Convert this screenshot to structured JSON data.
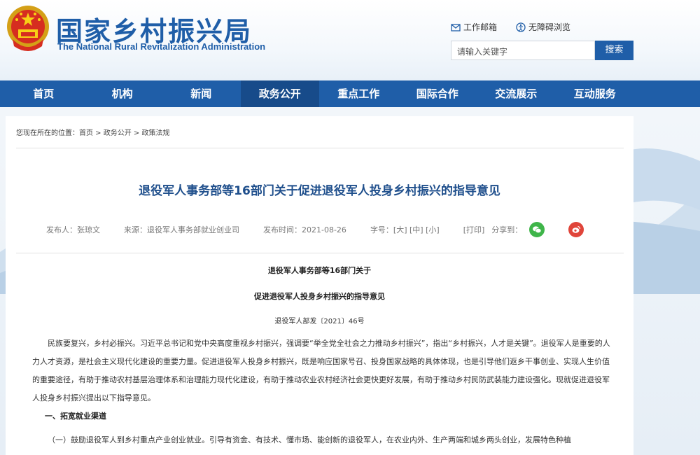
{
  "header": {
    "title": "国家乡村振兴局",
    "subtitle": "The National Rural Revitalization Administration",
    "util_links": [
      {
        "label": "工作邮箱",
        "icon": "mail-icon"
      },
      {
        "label": "无障碍浏览",
        "icon": "accessibility-icon"
      }
    ],
    "search": {
      "placeholder": "请输入关键字",
      "button": "搜索"
    }
  },
  "nav": {
    "items": [
      "首页",
      "机构",
      "新闻",
      "政务公开",
      "重点工作",
      "国际合作",
      "交流展示",
      "互动服务"
    ],
    "active_index": 3
  },
  "breadcrumb": "您现在所在的位置：首页 > 政务公开 > 政策法规",
  "article": {
    "title": "退役军人事务部等16部门关于促进退役军人投身乡村振兴的指导意见",
    "meta": {
      "publisher": "发布人：张琼文",
      "source": "来源：退役军人事务部就业创业司",
      "time": "发布时间：2021-08-26",
      "font_size": "字号：[大] [中] [小]",
      "print": "[打印]",
      "share_label": "分享到："
    },
    "doc_heading_1": "退役军人事务部等16部门关于",
    "doc_heading_2": "促进退役军人投身乡村振兴的指导意见",
    "doc_number": "退役军人部发〔2021〕46号",
    "paragraph_1": "民族要复兴，乡村必振兴。习近平总书记和党中央高度重视乡村振兴，强调要“举全党全社会之力推动乡村振兴”，指出“乡村振兴，人才是关键”。退役军人是重要的人力人才资源，是社会主义现代化建设的重要力量。促进退役军人投身乡村振兴，既是响应国家号召、投身国家战略的具体体现，也是引导他们返乡干事创业、实现人生价值的重要途径，有助于推动农村基层治理体系和治理能力现代化建设，有助于推动农业农村经济社会更快更好发展，有助于推动乡村民防武装能力建设强化。现就促进退役军人投身乡村振兴提出以下指导意见。",
    "section_1": "一、拓宽就业渠道",
    "paragraph_2": "（一）鼓励退役军人到乡村重点产业创业就业。引导有资金、有技术、懂市场、能创新的退役军人，在农业内外、生产两端和城乡两头创业，发展特色种植"
  },
  "colors": {
    "brand_blue": "#1f5ea8",
    "nav_active": "#174b8a",
    "wechat": "#3fb54a",
    "weibo": "#e0453a"
  }
}
